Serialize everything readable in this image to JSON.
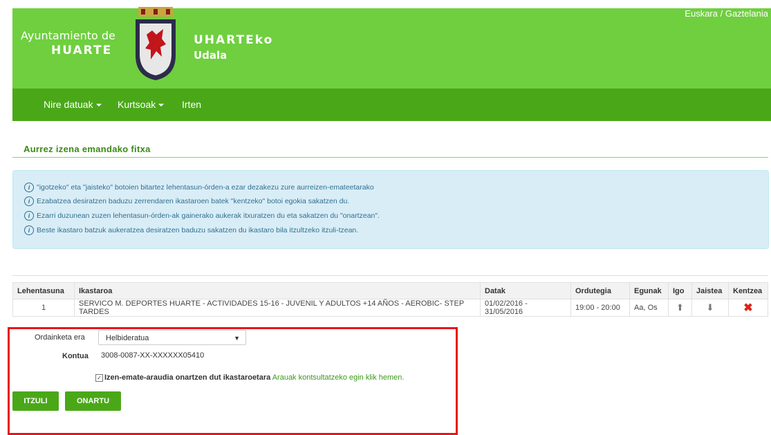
{
  "header": {
    "brand_left_line1": "Ayuntamiento de",
    "brand_left_line2": "HUARTE",
    "brand_right_line1": "UHARTEko",
    "brand_right_line2": "Udala",
    "lang_euskara": "Euskara",
    "lang_sep": " / ",
    "lang_gaztelania": "Gaztelania",
    "bg_color": "#6fcf3f"
  },
  "nav": {
    "items": [
      "Nire datuak",
      "Kurtsoak",
      "Irten"
    ],
    "bg_color": "#4aa818"
  },
  "page_title": "Aurrez izena emandako fitxa",
  "info": [
    "\"igotzeko\" eta \"jaisteko\" botoien bitartez lehentasun-órden-a ezar dezakezu zure aurreizen-emateetarako",
    "Ezabatzea desiratzen baduzu zerrendaren ikastaroen batek \"kentzeko\" botoi egokia sakatzen du.",
    "Ezarri duzunean zuzen lehentasun-órden-ak gainerako aukerak itxuratzen du eta sakatzen du \"onartzean\".",
    "Beste ikastaro batzuk aukeratzea desiratzen baduzu sakatzen du ikastaro bila itzultzeko itzuli-tzean."
  ],
  "table": {
    "headers": [
      "Lehentasuna",
      "Ikastaroa",
      "Datak",
      "Ordutegia",
      "Egunak",
      "Igo",
      "Jaistea",
      "Kentzea"
    ],
    "rows": [
      {
        "priority": "1",
        "course": "SERVICO M. DEPORTES HUARTE - ACTIVIDADES 15-16 - JUVENIL Y ADULTOS +14 AÑOS - AEROBIC- STEP TARDES",
        "dates": "01/02/2016 - 31/05/2016",
        "schedule": "19:00 - 20:00",
        "days": "Aa, Os",
        "up_icon": "arrow-up-icon",
        "down_icon": "arrow-down-icon",
        "delete_icon": "close-icon"
      }
    ]
  },
  "form": {
    "payment_label": "Ordainketa era",
    "payment_value": "Helbideratua",
    "account_label": "Kontua",
    "account_value": "3008-0087-XX-XXXXXX05410",
    "terms_text": "Izen-emate-araudia onartzen dut ikastaroetara",
    "terms_link": "Arauak kontsultatzeko egin klik hemen.",
    "back_button": "ITZULI",
    "accept_button": "ONARTU"
  }
}
